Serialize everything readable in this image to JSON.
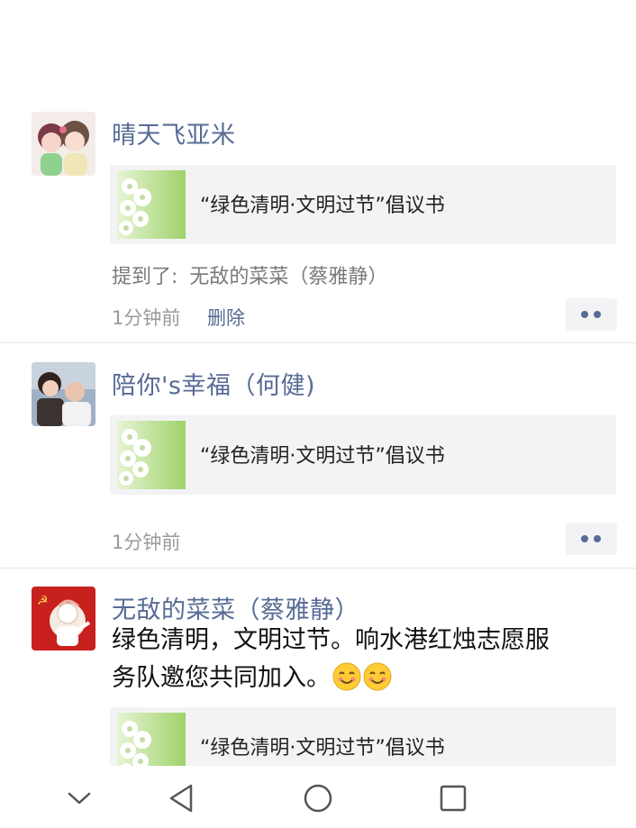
{
  "posts": [
    {
      "author": "晴天飞亚米",
      "link_title": "“绿色清明·文明过节”倡议书",
      "mention_label": "提到了:",
      "mention_name": "无敌的菜菜（蔡雅静）",
      "time": "1分钟前",
      "delete_label": "删除"
    },
    {
      "author": "陪你's幸福（何健)",
      "link_title": "“绿色清明·文明过节”倡议书",
      "time": "1分钟前"
    },
    {
      "author": "无敌的菜菜（蔡雅静）",
      "content_line1": "绿色清明，文明过节。响水港红烛志愿服",
      "content_line2": "务队邀您共同加入。",
      "link_title": "“绿色清明·文明过节”倡议书"
    }
  ],
  "colors": {
    "name_link": "#576b95",
    "card_bg": "#f3f3f5",
    "time_gray": "#9a9a9a",
    "divider": "#e6e6e6"
  },
  "icons": {
    "more": "more-dots-icon",
    "emoji": "smiling-face-icon",
    "nav": [
      "chevron-down-icon",
      "back-triangle-icon",
      "home-circle-icon",
      "recents-square-icon"
    ]
  }
}
